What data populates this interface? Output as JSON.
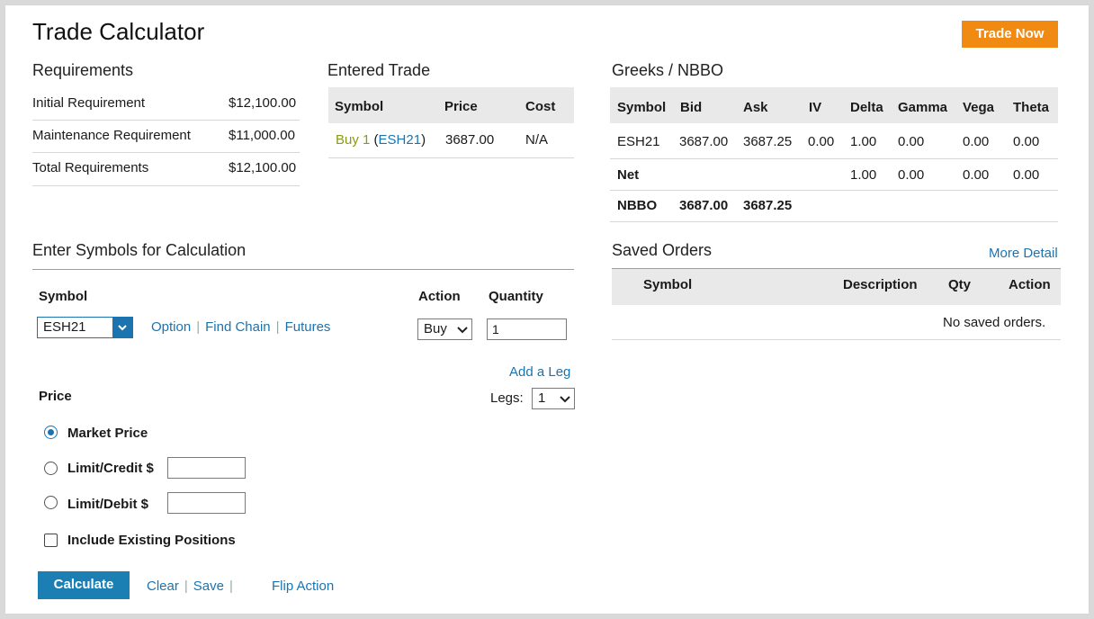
{
  "header": {
    "title": "Trade Calculator",
    "trade_now_label": "Trade Now"
  },
  "requirements": {
    "title": "Requirements",
    "rows": [
      {
        "label": "Initial Requirement",
        "value": "$12,100.00"
      },
      {
        "label": "Maintenance Requirement",
        "value": "$11,000.00"
      },
      {
        "label": "Total Requirements",
        "value": "$12,100.00"
      }
    ]
  },
  "entered_trade": {
    "title": "Entered Trade",
    "columns": [
      "Symbol",
      "Price",
      "Cost"
    ],
    "row": {
      "action": "Buy 1",
      "open_paren": "(",
      "symbol": "ESH21",
      "close_paren": ")",
      "price": "3687.00",
      "cost": "N/A"
    }
  },
  "greeks": {
    "title": "Greeks / NBBO",
    "columns": [
      "Symbol",
      "Bid",
      "Ask",
      "IV",
      "Delta",
      "Gamma",
      "Vega",
      "Theta"
    ],
    "rows": [
      [
        "ESH21",
        "3687.00",
        "3687.25",
        "0.00",
        "1.00",
        "0.00",
        "0.00",
        "0.00"
      ],
      [
        "Net",
        "",
        "",
        "",
        "1.00",
        "0.00",
        "0.00",
        "0.00"
      ],
      [
        "NBBO",
        "3687.00",
        "3687.25",
        "",
        "",
        "",
        "",
        ""
      ]
    ]
  },
  "saved_orders": {
    "title": "Saved Orders",
    "more_detail": "More Detail",
    "columns": [
      "Symbol",
      "Description",
      "Qty",
      "Action"
    ],
    "empty_text": "No saved orders."
  },
  "enter_symbols": {
    "title": "Enter Symbols for Calculation",
    "symbol_label": "Symbol",
    "action_label": "Action",
    "quantity_label": "Quantity",
    "symbol_value": "ESH21",
    "option_link": "Option",
    "find_chain_link": "Find Chain",
    "futures_link": "Futures",
    "separator": "|",
    "action_value": "Buy",
    "quantity_value": "1",
    "add_leg": "Add a Leg",
    "legs_label": "Legs:",
    "legs_value": "1"
  },
  "price": {
    "label": "Price",
    "market_price": "Market Price",
    "limit_credit": "Limit/Credit $",
    "limit_debit": "Limit/Debit $",
    "include_positions": "Include Existing Positions"
  },
  "footer": {
    "calculate": "Calculate",
    "clear": "Clear",
    "save": "Save",
    "separator": "|",
    "flip_action": "Flip Action"
  },
  "colors": {
    "orange": "#f08a12",
    "blue": "#1b7fb3",
    "link": "#1b74b0",
    "olive": "#8a9a16"
  }
}
